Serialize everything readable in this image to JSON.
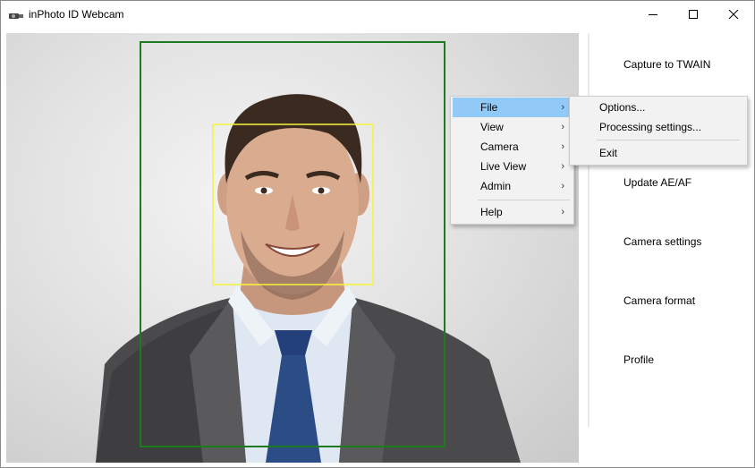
{
  "window": {
    "title": "inPhoto ID Webcam",
    "icon": "webcam-icon",
    "controls": [
      "minimize-icon",
      "maximize-icon",
      "close-icon"
    ]
  },
  "sidebar": {
    "buttons": [
      {
        "id": "capture-to-twain-button",
        "label": "Capture to TWAIN"
      },
      {
        "id": "update-ae-af-button",
        "label": "Update AE/AF"
      },
      {
        "id": "camera-settings-button",
        "label": "Camera settings"
      },
      {
        "id": "camera-format-button",
        "label": "Camera format"
      },
      {
        "id": "profile-button",
        "label": "Profile"
      }
    ]
  },
  "context_menu": {
    "items": [
      {
        "label": "File",
        "has_submenu": true,
        "active": true
      },
      {
        "label": "View",
        "has_submenu": true
      },
      {
        "label": "Camera",
        "has_submenu": true
      },
      {
        "label": "Live View",
        "has_submenu": true
      },
      {
        "label": "Admin",
        "has_submenu": true
      },
      {
        "label": "Help",
        "has_submenu": true
      }
    ],
    "arrow": "›"
  },
  "file_submenu": {
    "items": [
      {
        "label": "Options..."
      },
      {
        "label": "Processing settings..."
      },
      {
        "label": "Exit"
      }
    ]
  },
  "overlay": {
    "body_frame_color": "#1e7a1e",
    "face_frame_color": "#f5f53a",
    "highlight_color": "#91c9f7"
  }
}
